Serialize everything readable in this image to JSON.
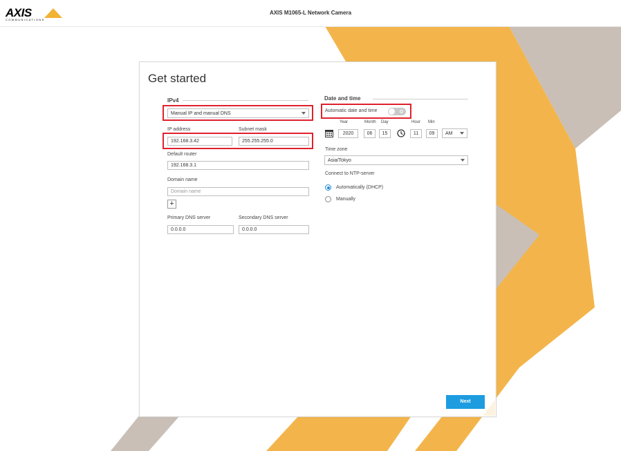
{
  "app": {
    "logo_text": "AXIS",
    "logo_sub": "COMMUNICATIONS",
    "title": "AXIS M1065-L Network Camera"
  },
  "page": {
    "heading": "Get started"
  },
  "ipv4": {
    "section_title": "IPv4",
    "mode_value": "Manual IP and manual DNS",
    "ip_label": "IP address",
    "ip_value": "192.168.3.42",
    "subnet_label": "Subnet mask",
    "subnet_value": "255.255.255.0",
    "router_label": "Default router",
    "router_value": "192.168.3.1",
    "domain_label": "Domain name",
    "domain_placeholder": "Domain name",
    "add_symbol": "+",
    "primary_dns_label": "Primary DNS server",
    "primary_dns_value": "0.0.0.0",
    "secondary_dns_label": "Secondary DNS server",
    "secondary_dns_value": "0.0.0.0"
  },
  "datetime": {
    "section_title": "Date and time",
    "auto_label": "Automatic date and time",
    "auto_enabled": false,
    "year_label": "Year",
    "month_label": "Month",
    "day_label": "Day",
    "hour_label": "Hour",
    "min_label": "Min",
    "year": "2020",
    "month": "06",
    "day": "15",
    "hour": "11",
    "min": "09",
    "ampm": "AM",
    "timezone_label": "Time zone",
    "timezone_value": "Asia/Tokyo",
    "ntp_label": "Connect to NTP-server",
    "ntp_options": [
      {
        "label": "Automatically (DHCP)",
        "selected": true
      },
      {
        "label": "Manually",
        "selected": false
      }
    ]
  },
  "actions": {
    "next_label": "Next"
  },
  "colors": {
    "accent_orange": "#f2b233",
    "accent_gray": "#c8beb6",
    "primary_button": "#1e9ce0",
    "highlight_red": "#e0202c"
  }
}
